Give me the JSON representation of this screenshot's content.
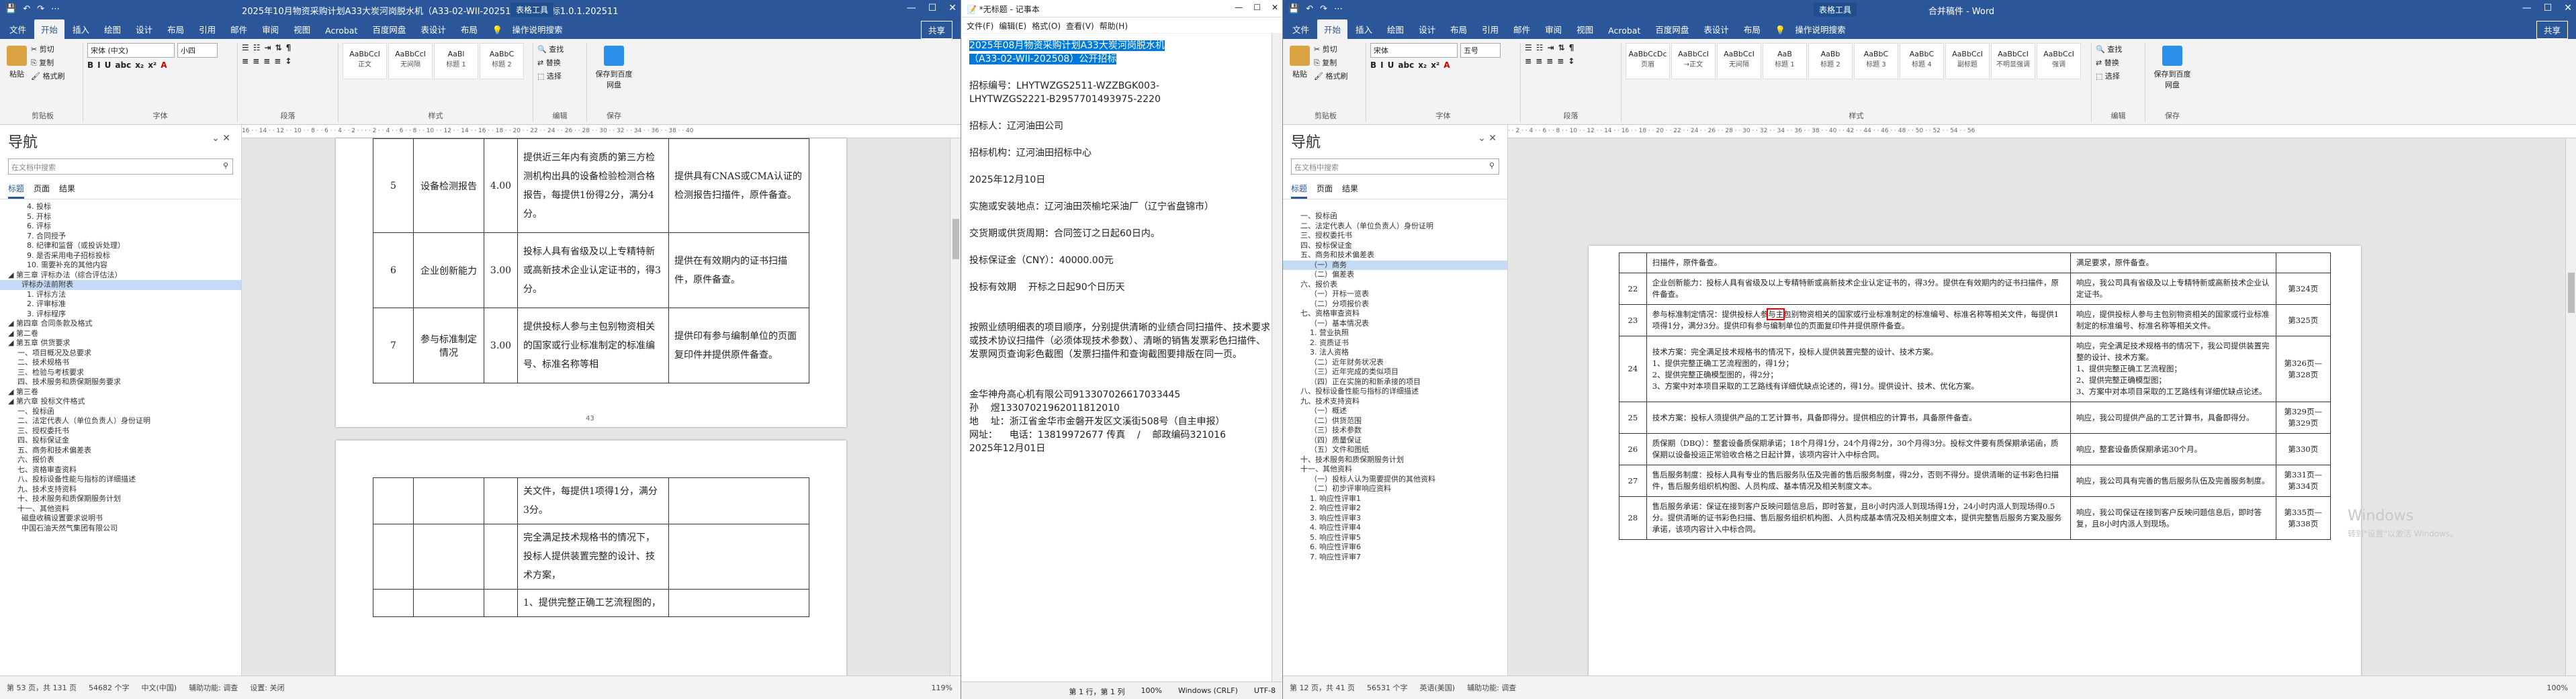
{
  "win1": {
    "title": "2025年10月物资采购计划A33大炭河岗脱水机（A33-02-WII-202510）公开招标1.0.1.20251119（...",
    "context_tab": "表格工具",
    "quick_access": [
      "💾",
      "↶",
      "↷",
      "⋯"
    ],
    "window_controls": [
      "—",
      "☐",
      "✕"
    ],
    "tabs": [
      "文件",
      "开始",
      "插入",
      "绘图",
      "设计",
      "布局",
      "引用",
      "邮件",
      "审阅",
      "视图",
      "Acrobat",
      "百度网盘",
      "表设计",
      "布局"
    ],
    "active_tab": "开始",
    "tell_me": "操作说明搜索",
    "share": "共享",
    "ribbon": {
      "paste": "粘贴",
      "clipboard_items": [
        "剪切",
        "复制",
        "格式刷"
      ],
      "clipboard_label": "剪贴板",
      "font_box": "宋体 (中文)",
      "size_box": "小四",
      "fmt": [
        "B",
        "I",
        "U",
        "abc",
        "x₂",
        "x²",
        "A"
      ],
      "font_label": "字体",
      "para_label": "段落",
      "styles": [
        {
          "sample": "AaBbCcI",
          "name": "正文"
        },
        {
          "sample": "AaBbCcI",
          "name": "无间隔"
        },
        {
          "sample": "AaBl",
          "name": "标题 1"
        },
        {
          "sample": "AaBbC",
          "name": "标题 2"
        }
      ],
      "styles_label": "样式",
      "edit_items": [
        "查找",
        "替换",
        "选择"
      ],
      "edit_label": "编辑",
      "save_baidu": "保存到百度网盘",
      "save_label": "保存"
    },
    "nav": {
      "heading": "导航",
      "search_placeholder": "在文档中搜索",
      "tabs": [
        "标题",
        "页面",
        "结果"
      ],
      "items": [
        "4. 投标",
        "5. 开标",
        "6. 评标",
        "7. 合同授予",
        "8. 纪律和监督（或投诉处理）",
        "9. 是否采用电子招标投标",
        "10. 需要补充的其他内容",
        "第三章 评标办法（综合评估法）",
        "评标办法前附表",
        "1. 评标方法",
        "2. 评审标准",
        "3. 评标程序",
        "第四章 合同条款及格式",
        "第二卷",
        "第五章 供货要求",
        "一、项目概况及总要求",
        "二、技术规格书",
        "三、检验与考核要求",
        "四、技术服务和质保期服务要求",
        "第三卷",
        "第六章 投标文件格式",
        "一、投标函",
        "二、法定代表人（单位负责人）身份证明",
        "三、授权委托书",
        "四、投标保证金",
        "五、商务和技术偏差表",
        "六、报价表",
        "七、资格审查资料",
        "八、投标设备性能与指标的详细描述",
        "九、技术支持资料",
        "十、技术服务和质保期服务计划",
        "十一、其他资料",
        "磁盘收稿设置要求说明书",
        "中国石油天然气集团有限公司"
      ],
      "selected": "评标办法前附表"
    },
    "ruler": "16 · · 14 · · 12 · · 10 · · 8 · · 6 · · 4 · · 2 · · · · 2 · · 4 · · 6 · · 8 · · 10 · · 12 · · 14 · · 16 · · 18 · · 20 · · 22 · · 24 · · 26 · · 28 · · 30 · · 32 · · 34 · · 36 · · 38 · · 40",
    "rows": [
      {
        "no": "5",
        "item": "设备检测报告",
        "score": "4.00",
        "crit": "提供近三年内有资质的第三方检测机构出具的设备检验检测合格报告，每提供1份得2分，满分4分。",
        "evid": "提供具有CNAS或CMA认证的检测报告扫描件，原件备查。"
      },
      {
        "no": "6",
        "item": "企业创新能力",
        "score": "3.00",
        "crit": "投标人具有省级及以上专精特新或高新技术企业认定证书的，得3分。",
        "evid": "提供在有效期内的证书扫描件，原件备查。"
      },
      {
        "no": "7",
        "item": "参与标准制定情况",
        "score": "3.00",
        "crit": "提供投标人参与主包别物资相关的国家或行业标准制定的标准编号、标准名称等相",
        "evid": "提供印有参与编制单位的页面复印件并提供原件备查。"
      }
    ],
    "page_num": "43",
    "rows2": [
      {
        "crit": "关文件，每提供1项得1分，满分3分。"
      },
      {
        "crit": "完全满足技术规格书的情况下，投标人提供装置完整的设计、技术方案，"
      },
      {
        "crit": "1、提供完整正确工艺流程图的，"
      }
    ],
    "highlight": "参与与主",
    "status": [
      "第 53 页，共 131 页",
      "54682 个字",
      "中文(中国)",
      "辅助功能: 调查",
      "设置: 关闭"
    ],
    "zoom": "119%"
  },
  "notepad": {
    "title": "*无标题 - 记事本",
    "controls": [
      "—",
      "☐",
      "✕"
    ],
    "menu": [
      "文件(F)",
      "编辑(E)",
      "格式(O)",
      "查看(V)",
      "帮助(H)"
    ],
    "sel1": "2025年08月物资采购计划A33大炭河岗脱水机",
    "sel2": "（A33-02-WII-202508）公开招标",
    "lines": [
      "",
      "招标编号：LHYTWZGS2511-WZZBGK003-",
      "LHYTWZGS2221-B2957701493975-2220",
      "",
      "招标人：辽河油田公司",
      "",
      "招标机构：辽河油田招标中心",
      "",
      "2025年12月10日",
      "",
      "实施或安装地点：辽河油田茨榆坨采油厂（辽宁省盘锦市）",
      "",
      "交货期或供货周期：合同签订之日起60日内。",
      "",
      "投标保证金（CNY）：40000.00元",
      "",
      "投标有效期    开标之日起90个日历天",
      "",
      "",
      "按照业绩明细表的项目顺序，分别提供清晰的业绩合同扫描件、技术要求或技术协议扫描件（必须体现技术参数）、清晰的销售发票彩色扫描件、发票网页查询彩色截图（发票扫描件和查询截图要排版在同一页。",
      "",
      "",
      "金华神舟高心机有限公司913307026617033445",
      "孙    煜13307021962011812010",
      "地    址：浙江省金华市金磐开发区文溪街508号（自主申报）",
      "网址：    电话：13819972677 传真    /    邮政编码321016",
      "2025年12月01日"
    ],
    "status": [
      "第 1 行，第 1 列",
      "100%",
      "Windows (CRLF)",
      "UTF-8"
    ]
  },
  "win3": {
    "title": "合并稿件 - Word",
    "context_tab": "表格工具",
    "quick_access": [
      "💾",
      "↶",
      "↷",
      "⋯"
    ],
    "window_controls": [
      "—",
      "☐",
      "✕"
    ],
    "tabs": [
      "文件",
      "开始",
      "插入",
      "绘图",
      "设计",
      "布局",
      "引用",
      "邮件",
      "审阅",
      "视图",
      "Acrobat",
      "百度网盘",
      "表设计",
      "布局"
    ],
    "active_tab": "开始",
    "tell_me": "操作说明搜索",
    "share": "共享",
    "ribbon": {
      "paste": "粘贴",
      "clipboard_items": [
        "剪切",
        "复制",
        "格式刷"
      ],
      "clipboard_label": "剪贴板",
      "font_box": "宋体",
      "size_box": "五号",
      "fmt": [
        "B",
        "I",
        "U",
        "abc",
        "x₂",
        "x²",
        "A"
      ],
      "font_label": "字体",
      "para_label": "段落",
      "styles": [
        {
          "sample": "AaBbCcDc",
          "name": "页眉"
        },
        {
          "sample": "AaBbCcI",
          "name": "→正文"
        },
        {
          "sample": "AaBbCcI",
          "name": "无间隔"
        },
        {
          "sample": "AaB",
          "name": "标题 1"
        },
        {
          "sample": "AaBb",
          "name": "标题 2"
        },
        {
          "sample": "AaBbC",
          "name": "标题 3"
        },
        {
          "sample": "AaBbC",
          "name": "标题 4"
        },
        {
          "sample": "AaBbCcI",
          "name": "副标题"
        },
        {
          "sample": "AaBbCcI",
          "name": "不明显强调"
        },
        {
          "sample": "AaBbCcI",
          "name": "强调"
        }
      ],
      "styles_label": "样式",
      "edit_items": [
        "查找",
        "替换",
        "选择"
      ],
      "edit_label": "编辑",
      "save_baidu": "保存到百度网盘",
      "save_label": "保存"
    },
    "nav": {
      "heading": "导航",
      "search_placeholder": "在文档中搜索",
      "tabs": [
        "标题",
        "页面",
        "结果"
      ],
      "items": [
        "一、投标函",
        "二、法定代表人（单位负责人）身份证明",
        "三、授权委托书",
        "四、投标保证金",
        "五、商务和技术偏差表",
        "（一）商务",
        "（二）偏差表",
        "六、报价表",
        "（一）开标一览表",
        "（二）分项报价表",
        "七、资格审查资料",
        "（一）基本情况表",
        "1. 营业执照",
        "2. 资质证书",
        "3. 法人资格",
        "（二）近年财务状况表",
        "（三）近年完成的类似项目",
        "（四）正在实施的和新承接的项目",
        "八、投标设备性能与指标的详细描述",
        "九、技术支持资料",
        "（一）概述",
        "（二）供货范围",
        "（三）技术参数",
        "（四）质量保证",
        "（五）文件和图纸",
        "十、技术服务和质保期服务计划",
        "十一、其他资料",
        "（一）投标人认为需要提供的其他资料",
        "（二）初步评审响应资料",
        "1. 响应性评审1",
        "2. 响应性评审2",
        "3. 响应性评审3",
        "4. 响应性评审4",
        "5. 响应性评审5",
        "6. 响应性评审6",
        "7. 响应性评审7"
      ],
      "selected": "（一）商务"
    },
    "ruler": "· · 2 · · 4 · · 6 · · 8 · · 10 · · 12 · · 14 · · 16 · · 18 · · 20 · · 22 · · 24 · · 26 · · 28 · · 30 · · 32 · · 34 · · 36 · · 38 · · 40 · · 42 · · 44 · · 46 · · 48 · · 50 · · 52 · · 54 · · 56",
    "top_row": {
      "c": "扫描件，原件备查。",
      "r": "满足要求，原件备查。"
    },
    "rows": [
      {
        "no": "22",
        "req": "企业创新能力：投标人具有省级及以上专精特新或高新技术企业认定证书的，得3分。提供在有效期内的证书扫描件，原件备查。",
        "resp": "响应，我公司具有省级及以上专精特新或高新技术企业认定证书。",
        "page": "第324页"
      },
      {
        "no": "23",
        "req": "参与标准制定情况：提供投标人参与主包别物资相关的国家或行业标准制定的标准编号、标准名称等相关文件，每提供1项得1分，满分3分。提供印有参与编制单位的页面复印件并提供原件备查。",
        "resp": "响应，提供投标人参与主包别物资相关的国家或行业标准制定的标准编号、标准名称等相关文件。",
        "page": "第325页"
      },
      {
        "no": "24",
        "req": "技术方案：完全满足技术规格书的情况下，投标人提供装置完整的设计、技术方案。\n1、提供完整正确工艺流程图的，得1分；\n2、提供完整正确模型图的，得2分；\n3、方案中对本项目采取的工艺路线有详细优缺点论述的，得1分。提供设计、技术、优化方案。",
        "resp": "响应，完全满足技术规格书的情况下，我公司提供装置完整的设计、技术方案。\n1、提供完整正确工艺流程图；\n2、提供完整正确模型图；\n3、方案中对本项目采取的工艺路线有详细优缺点论述。",
        "page": "第326页—第328页"
      },
      {
        "no": "25",
        "req": "技术方案：投标人须提供产品的工艺计算书，具备即得分。提供相应的计算书，具备原件备查。",
        "resp": "响应，我公司提供产品的工艺计算书，具备即得分。",
        "page": "第329页—第329页"
      },
      {
        "no": "26",
        "req": "质保期（DBQ）：整套设备质保期承诺；18个月得1分，24个月得2分，30个月得3分。投标文件要有质保期承诺函，质保期以设备投运正常验收合格之日起计算，该项内容计入中标合同。",
        "resp": "响应，整套设备质保期承诺30个月。",
        "page": "第330页"
      },
      {
        "no": "27",
        "req": "售后服务制度：投标人具有专业的售后服务队伍及完善的售后服务制度，得2分，否则不得分。提供清晰的证书彩色扫描件，售后服务组织机构图、人员构成、基本情况及相关制度文本。",
        "resp": "响应，我公司具有完善的售后服务队伍及完善服务制度。",
        "page": "第331页—第334页"
      },
      {
        "no": "28",
        "req": "售后服务承诺：保证在接到客户反映问题信息后，即时答复，且8小时内派人到现场得1分，24小时内派人到现场得0.5分。提供清晰的证书彩色扫描、售后服务组织机构图、人员构成基本情况及相关制度文本，提供完整售后服务方案及服务承诺，该项内容计入中标合同。",
        "resp": "响应，我公司保证在接到客户反映问题信息后，即时答复，且8小时内派人到现场。",
        "page": "第335页—第338页"
      }
    ],
    "highlight": "与主",
    "watermark": "Windows\n转到\"设置\"以激活 Windows。",
    "status": [
      "第 12 页，共 41 页",
      "56531 个字",
      "英语(美国)",
      "辅助功能: 调查"
    ],
    "zoom": "100%"
  },
  "colors": {
    "accent": "#2b579a",
    "highlight": "#0078d7",
    "redbox": "#e00000"
  }
}
